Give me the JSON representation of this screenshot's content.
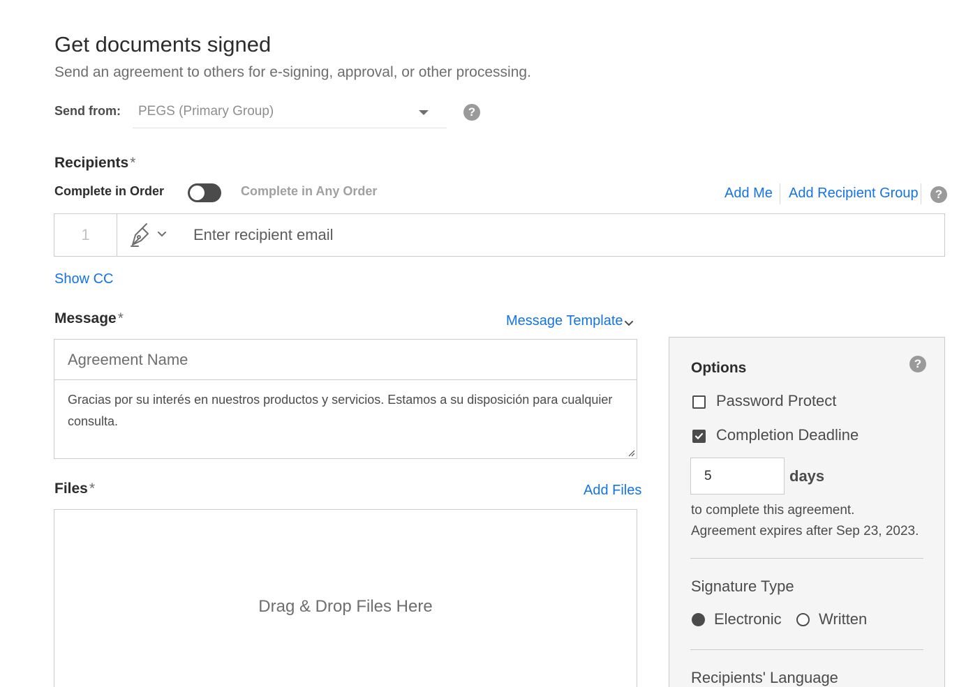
{
  "header": {
    "title": "Get documents signed",
    "subtitle": "Send an agreement to others for e-signing, approval, or other processing."
  },
  "send_from": {
    "label": "Send from:",
    "value": "PEGS (Primary Group)"
  },
  "recipients": {
    "label": "Recipients",
    "required_mark": "*",
    "complete_in_order_label": "Complete in Order",
    "complete_any_order_label": "Complete in Any Order",
    "order_toggle_on": false,
    "add_me_label": "Add Me",
    "add_group_label": "Add Recipient Group",
    "rows": [
      {
        "number": "1",
        "email_placeholder": "Enter recipient email"
      }
    ],
    "show_cc_label": "Show CC"
  },
  "message": {
    "label": "Message",
    "required_mark": "*",
    "template_label": "Message Template",
    "agreement_name_placeholder": "Agreement Name",
    "body": "Gracias por su interés en nuestros productos y servicios.  Estamos a su disposición para cualquier consulta."
  },
  "files": {
    "label": "Files",
    "required_mark": "*",
    "add_files_label": "Add Files",
    "drop_text": "Drag & Drop Files Here"
  },
  "options": {
    "title": "Options",
    "password_protect_label": "Password Protect",
    "password_protect_checked": false,
    "completion_deadline_label": "Completion Deadline",
    "completion_deadline_checked": true,
    "days_value": "5",
    "days_label": "days",
    "deadline_text": "to complete this agreement.",
    "expires_text": "Agreement expires after Sep 23, 2023.",
    "signature_type_label": "Signature Type",
    "electronic_label": "Electronic",
    "written_label": "Written",
    "selected_signature_type": "Electronic",
    "recipients_language_label": "Recipients' Language"
  },
  "icons": {
    "help": "help-icon",
    "dropdown": "chevron-down-icon",
    "role": "pen-nib-icon"
  },
  "colors": {
    "link": "#1473e6",
    "text": "#2c2c2c",
    "muted": "#6e6e6e",
    "panel_bg": "#f5f5f5"
  }
}
